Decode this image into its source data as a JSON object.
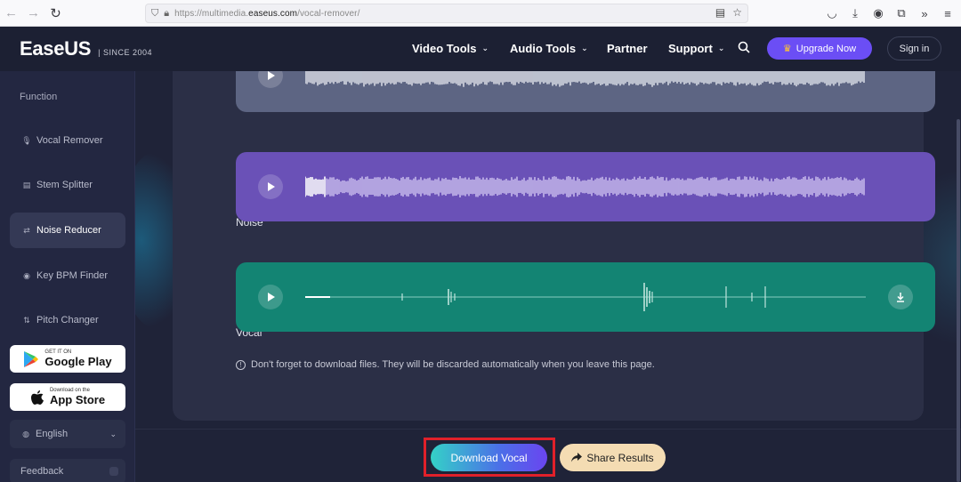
{
  "browser": {
    "url_prefix": "https://multimedia.",
    "url_domain": "easeus.com",
    "url_path": "/vocal-remover/"
  },
  "header": {
    "logo": "EaseUS",
    "since": "| SINCE 2004",
    "nav": [
      {
        "label": "Video Tools",
        "has_dropdown": true
      },
      {
        "label": "Audio Tools",
        "has_dropdown": true
      },
      {
        "label": "Partner",
        "has_dropdown": false
      },
      {
        "label": "Support",
        "has_dropdown": true
      }
    ],
    "upgrade_label": "Upgrade Now",
    "signin_label": "Sign in"
  },
  "sidebar": {
    "title": "Function",
    "items": [
      {
        "label": "Vocal Remover",
        "icon": "microphone-icon",
        "active": false
      },
      {
        "label": "Stem Splitter",
        "icon": "stem-icon",
        "active": false
      },
      {
        "label": "Noise Reducer",
        "icon": "noise-icon",
        "active": true
      },
      {
        "label": "Key BPM Finder",
        "icon": "bpm-icon",
        "active": false
      },
      {
        "label": "Pitch Changer",
        "icon": "pitch-icon",
        "active": false
      }
    ],
    "google_play": {
      "small": "GET IT ON",
      "big": "Google Play"
    },
    "app_store": {
      "small": "Download on the",
      "big": "App Store"
    },
    "language": "English",
    "feedback": "Feedback"
  },
  "tracks": {
    "noise_label": "Noise",
    "vocal_label": "Vocal"
  },
  "notice": "Don't forget to download files. They will be discarded automatically when you leave this page.",
  "actions": {
    "download_label": "Download Vocal",
    "share_label": "Share Results"
  },
  "colors": {
    "accent_purple": "#6b4ef5",
    "noise_track": "#6a51b7",
    "vocal_track": "#138473",
    "highlight": "#e0202a"
  }
}
